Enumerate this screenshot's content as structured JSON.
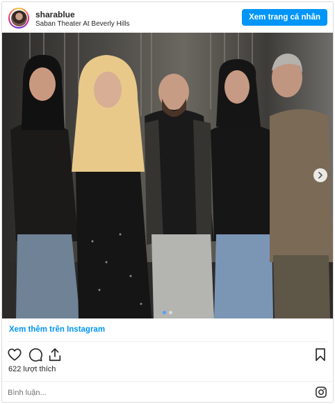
{
  "header": {
    "username": "sharablue",
    "location": "Saban Theater At Beverly Hills",
    "profile_button": "Xem trang cá nhân"
  },
  "post": {
    "carousel": {
      "total_slides": 2,
      "current_slide": 1
    },
    "view_more_link": "Xem thêm trên Instagram",
    "likes": "622 lượt thích",
    "comment_placeholder": "Bình luận..."
  },
  "icons": {
    "like": "heart-icon",
    "comment": "comment-icon",
    "share": "share-icon",
    "save": "bookmark-icon",
    "brand": "instagram-icon",
    "next": "chevron-right-icon"
  },
  "colors": {
    "accent": "#0095f6",
    "text": "#262626",
    "muted": "#737373",
    "border": "#dbdbdb"
  }
}
